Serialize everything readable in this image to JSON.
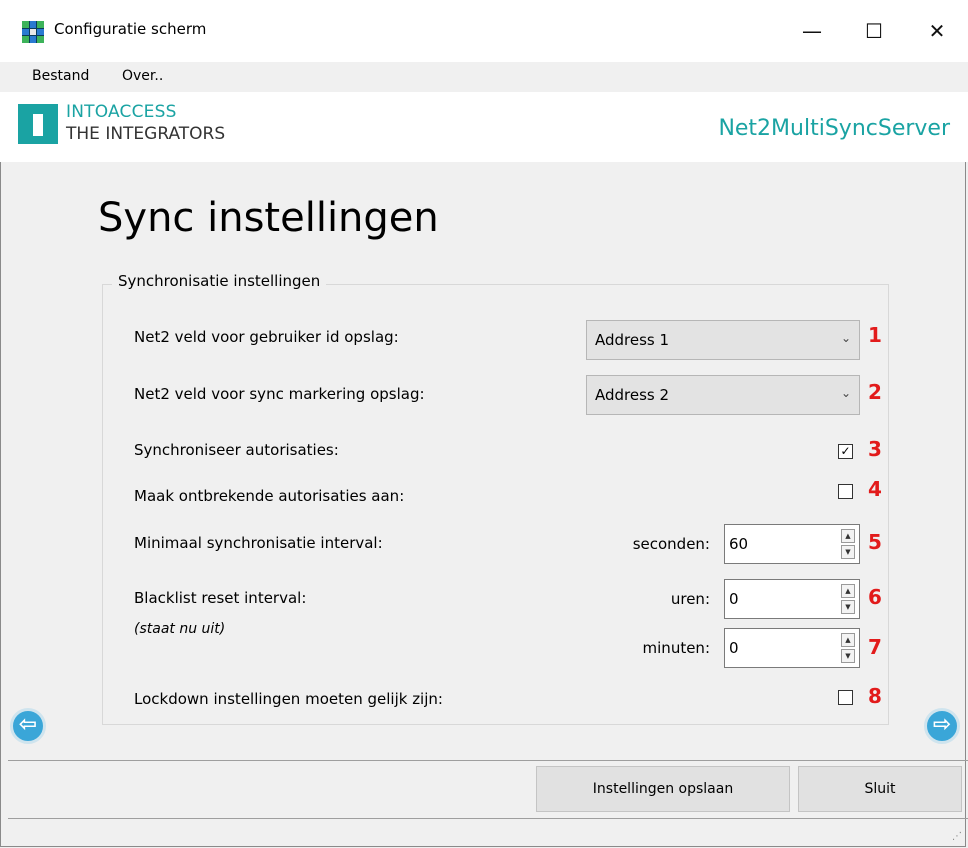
{
  "window": {
    "title": "Configuratie scherm",
    "minimize": "—",
    "maximize": "☐",
    "close": "✕"
  },
  "menu": [
    "Bestand",
    "Over.."
  ],
  "header": {
    "brand_line1": "INTOACCESS",
    "brand_line2": "THE INTEGRATORS",
    "product": "Net2MultiSyncServer"
  },
  "page_title": "Sync instellingen",
  "group": {
    "legend": "Synchronisatie instellingen",
    "user_id_field": {
      "label": "Net2 veld voor gebruiker id opslag:",
      "value": "Address 1",
      "number": "1"
    },
    "sync_mark_field": {
      "label": "Net2 veld voor sync markering opslag:",
      "value": "Address 2",
      "number": "2"
    },
    "sync_auth": {
      "label": "Synchroniseer autorisaties:",
      "checked": true,
      "check_glyph": "✓",
      "number": "3"
    },
    "create_missing": {
      "label": "Maak ontbrekende autorisaties aan:",
      "checked": false,
      "number": "4"
    },
    "min_interval": {
      "label": "Minimaal synchronisatie interval:",
      "unit": "seconden:",
      "value": "60",
      "number": "5"
    },
    "blacklist": {
      "label": "Blacklist reset interval:",
      "sublabel": "(staat nu uit)",
      "hours_unit": "uren:",
      "hours_value": "0",
      "hours_number": "6",
      "minutes_unit": "minuten:",
      "minutes_value": "0",
      "minutes_number": "7"
    },
    "lockdown": {
      "label": "Lockdown instellingen moeten gelijk zijn:",
      "checked": false,
      "number": "8"
    }
  },
  "buttons": {
    "save": "Instellingen opslaan",
    "close": "Sluit"
  },
  "nav": {
    "prev_glyph": "⇦",
    "next_glyph": "⇨"
  },
  "colors": {
    "accent": "#1aa3a3",
    "annotation": "#e21b1b",
    "nav": "#3aa6d8"
  }
}
